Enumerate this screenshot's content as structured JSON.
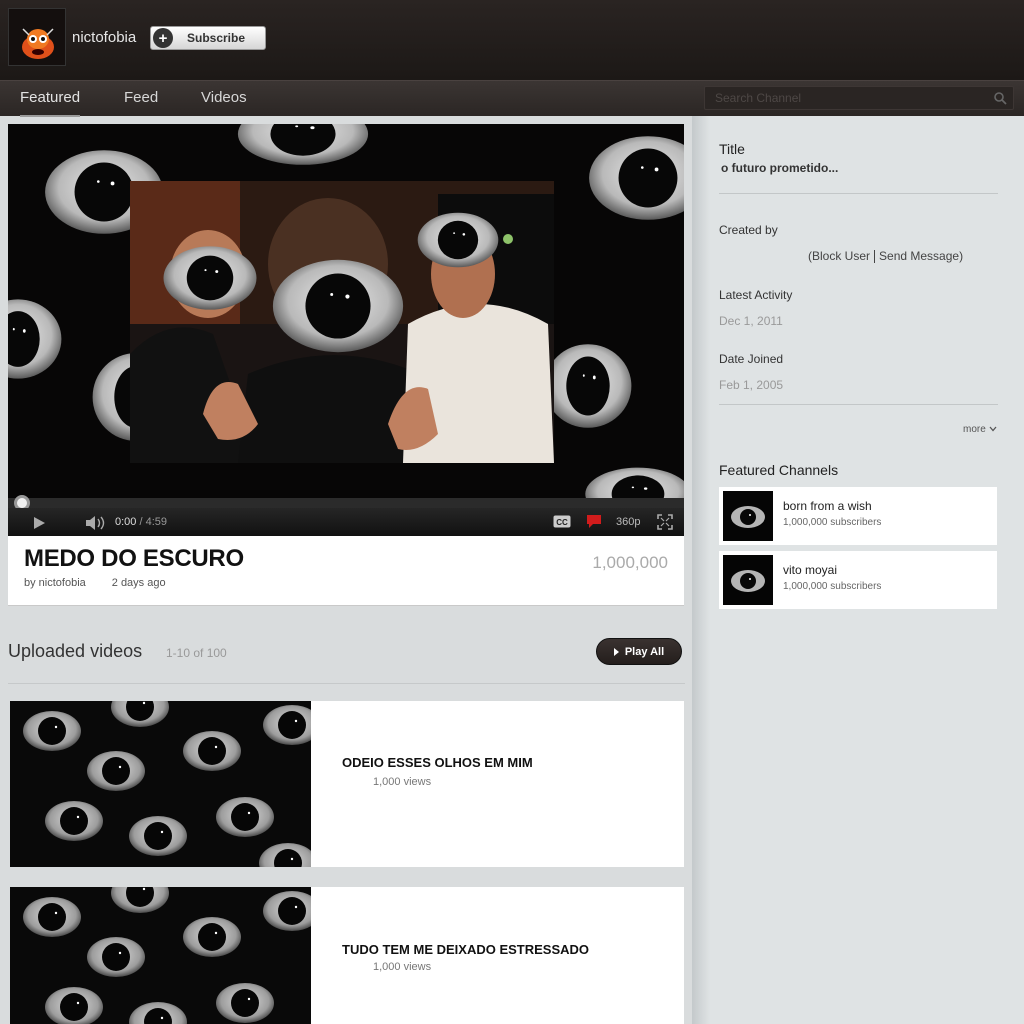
{
  "channel": {
    "name": "nictofobia",
    "subscribe_label": "Subscribe"
  },
  "nav": {
    "tabs": [
      {
        "label": "Featured",
        "active": true
      },
      {
        "label": "Feed",
        "active": false
      },
      {
        "label": "Videos",
        "active": false
      }
    ],
    "search_placeholder": "Search Channel"
  },
  "player": {
    "current_time": "0:00",
    "separator": " / ",
    "duration": "4:59",
    "quality": "360p",
    "progress_fraction": 0
  },
  "featured_video": {
    "title": "MEDO DO ESCURO",
    "by": "by nictofobia",
    "age": "2 days ago",
    "views": "1,000,000"
  },
  "uploads": {
    "heading": "Uploaded videos",
    "range": "1-10 of 100",
    "play_all_label": "Play All",
    "videos": [
      {
        "title": "ODEIO ESSES OLHOS EM MIM",
        "views": "1,000 views"
      },
      {
        "title": "TUDO TEM ME DEIXADO ESTRESSADO",
        "views": "1,000 views"
      }
    ]
  },
  "sidebar": {
    "title_label": "Title",
    "title_value": "o futuro prometido...",
    "created_by_label": "Created by",
    "block_user": "(Block User",
    "send_message": "Send Message)",
    "latest_activity_label": "Latest Activity",
    "latest_activity_value": "Dec 1, 2011",
    "date_joined_label": "Date Joined",
    "date_joined_value": "Feb 1, 2005",
    "more_label": "more",
    "featured_channels_heading": "Featured Channels",
    "featured_channels": [
      {
        "name": "born from a wish",
        "subscribers": "1,000,000 subscribers"
      },
      {
        "name": "vito moyai",
        "subscribers": "1,000,000 subscribers"
      }
    ]
  },
  "colors": {
    "header_bg": "#231e1c",
    "nav_bg": "#332d2b",
    "page_bg": "#d9dcdd",
    "sidebar_bg": "#dfe3e4",
    "cc_button": "#d11c1c"
  },
  "icons": [
    "plus-icon",
    "search-icon",
    "play-icon",
    "volume-icon",
    "cc-icon",
    "annotation-icon",
    "fullscreen-icon",
    "chevron-down-icon",
    "play-triangle-icon"
  ]
}
